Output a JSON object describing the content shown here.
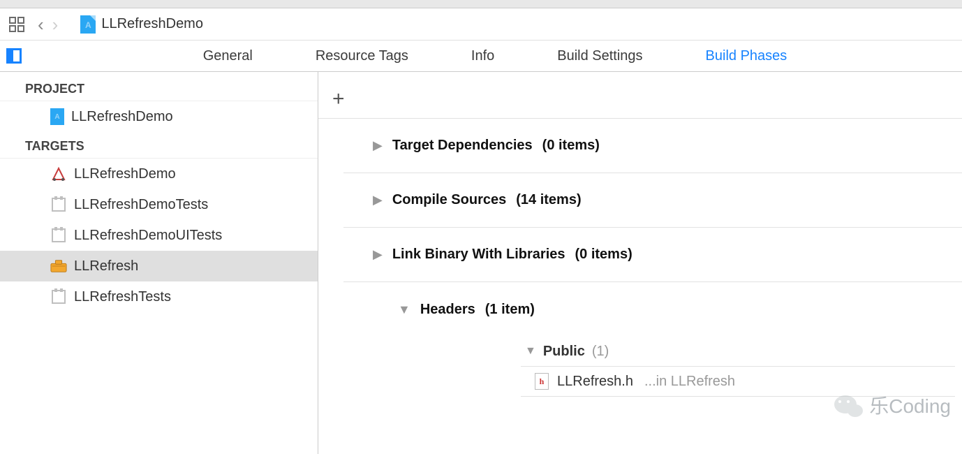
{
  "nav": {
    "project": "LLRefreshDemo"
  },
  "tabs": [
    {
      "label": "General",
      "active": false
    },
    {
      "label": "Resource Tags",
      "active": false
    },
    {
      "label": "Info",
      "active": false
    },
    {
      "label": "Build Settings",
      "active": false
    },
    {
      "label": "Build Phases",
      "active": true
    }
  ],
  "sidebar": {
    "projectHeader": "PROJECT",
    "project": "LLRefreshDemo",
    "targetsHeader": "TARGETS",
    "targets": [
      {
        "name": "LLRefreshDemo",
        "icon": "app",
        "selected": false
      },
      {
        "name": "LLRefreshDemoTests",
        "icon": "test",
        "selected": false
      },
      {
        "name": "LLRefreshDemoUITests",
        "icon": "test",
        "selected": false
      },
      {
        "name": "LLRefresh",
        "icon": "tool",
        "selected": true
      },
      {
        "name": "LLRefreshTests",
        "icon": "test",
        "selected": false
      }
    ]
  },
  "phases": {
    "targetDeps": {
      "title": "Target Dependencies",
      "count": "(0 items)"
    },
    "compile": {
      "title": "Compile Sources",
      "count": "(14 items)"
    },
    "linkBinary": {
      "title": "Link Binary With Libraries",
      "count": "(0 items)"
    },
    "headers": {
      "title": "Headers",
      "count": "(1 item)"
    },
    "public": {
      "title": "Public",
      "count": "(1)"
    },
    "file": {
      "name": "LLRefresh.h",
      "loc": "...in LLRefresh"
    }
  },
  "plus": "+",
  "watermark": "乐Coding"
}
